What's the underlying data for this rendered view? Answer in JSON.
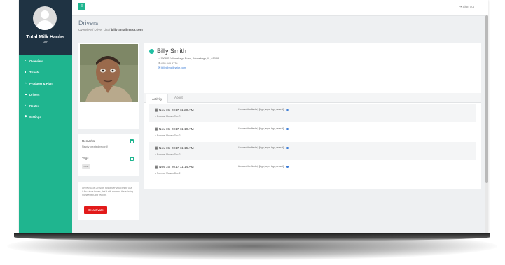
{
  "app": {
    "brand": "Total Milk Hauler",
    "brand_sub": "OFF"
  },
  "colors": {
    "accent": "#1fb58f",
    "sidebar_header": "#1f3343",
    "danger": "#e21a1a",
    "status_active": "#21bfa3"
  },
  "sidebar": {
    "items": [
      {
        "label": "Overview",
        "icon": "gauge-icon"
      },
      {
        "label": "Tickets",
        "icon": "file-icon"
      },
      {
        "label": "Producer & Plant",
        "icon": "barn-icon"
      },
      {
        "label": "Drivers",
        "icon": "truck-icon"
      },
      {
        "label": "Routes",
        "icon": "map-marker-icon"
      },
      {
        "label": "Settings",
        "icon": "gears-icon"
      }
    ]
  },
  "topbar": {
    "signout_label": "Sign out"
  },
  "page": {
    "title": "Drivers"
  },
  "breadcrumb": {
    "overview": "Overview",
    "driver_list": "Driver List",
    "current": "billy@mailinator.com"
  },
  "notes": {
    "remarks_label": "Remarks",
    "remarks_text": "Newly created record!",
    "tags_label": "Tags",
    "tag_chip": "none"
  },
  "deactivate": {
    "text": "Once you de-activate this driver you cannot use it for future tickets, but it still remains the existing manifested and reports.",
    "button_label": "De-activate"
  },
  "driver": {
    "name": "Billy Smith",
    "address": "1908 S. Winnebago Road, Winnebago, IL, 61088",
    "phone": "855.845.5776",
    "email": "billy@mailinator.com"
  },
  "tabs": [
    {
      "label": "Activity"
    },
    {
      "label": "About"
    }
  ],
  "activity": [
    {
      "date": "Nov 15, 2017 11:20 AM",
      "user": "Rommel Manalo Dec 2",
      "desc": "Updated the field(s) [logo,large, logo,default]"
    },
    {
      "date": "Nov 15, 2017 11:19 AM",
      "user": "Rommel Manalo Dec 2",
      "desc": "Updated the field(s) [logo,large, logo,default]"
    },
    {
      "date": "Nov 15, 2017 11:15 AM",
      "user": "Rommel Manalo Dec 2",
      "desc": "Updated the field(s) [logo,large, logo,default]"
    },
    {
      "date": "Nov 15, 2017 11:14 AM",
      "user": "Rommel Manalo Dec 2",
      "desc": "Updated the field(s) [logo,large, logo,default]"
    }
  ]
}
